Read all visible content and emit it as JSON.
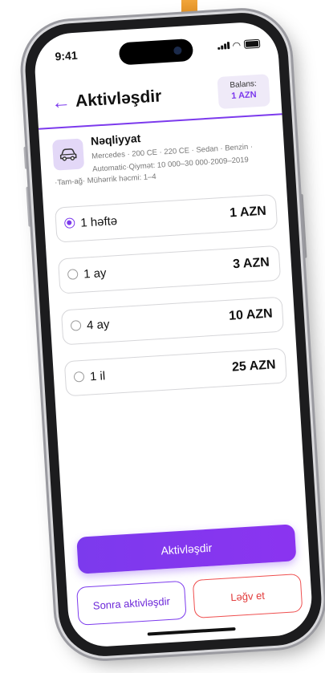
{
  "status": {
    "time": "9:41"
  },
  "header": {
    "title": "Aktivləşdir",
    "balance_label": "Balans:",
    "balance_value": "1 AZN"
  },
  "ad": {
    "category": "Nəqliyyat",
    "description_line1": "Mercedes · 200 CE · 220 CE · Sedan · Benzin · Automatic·Qiymət: 10 000–30 000·2009–2019",
    "description_line2": "·Tam-ağ· Mühərrik həcmi: 1–4",
    "icon": "car-icon"
  },
  "plans": [
    {
      "label": "1 həftə",
      "price": "1 AZN",
      "selected": true
    },
    {
      "label": "1 ay",
      "price": "3 AZN",
      "selected": false
    },
    {
      "label": "4 ay",
      "price": "10 AZN",
      "selected": false
    },
    {
      "label": "1 il",
      "price": "25 AZN",
      "selected": false
    }
  ],
  "actions": {
    "activate": "Aktivləşdir",
    "activate_later": "Sonra aktivləşdir",
    "cancel": "Ləğv et"
  },
  "colors": {
    "accent": "#7c3aed",
    "danger": "#ef4f4f"
  }
}
